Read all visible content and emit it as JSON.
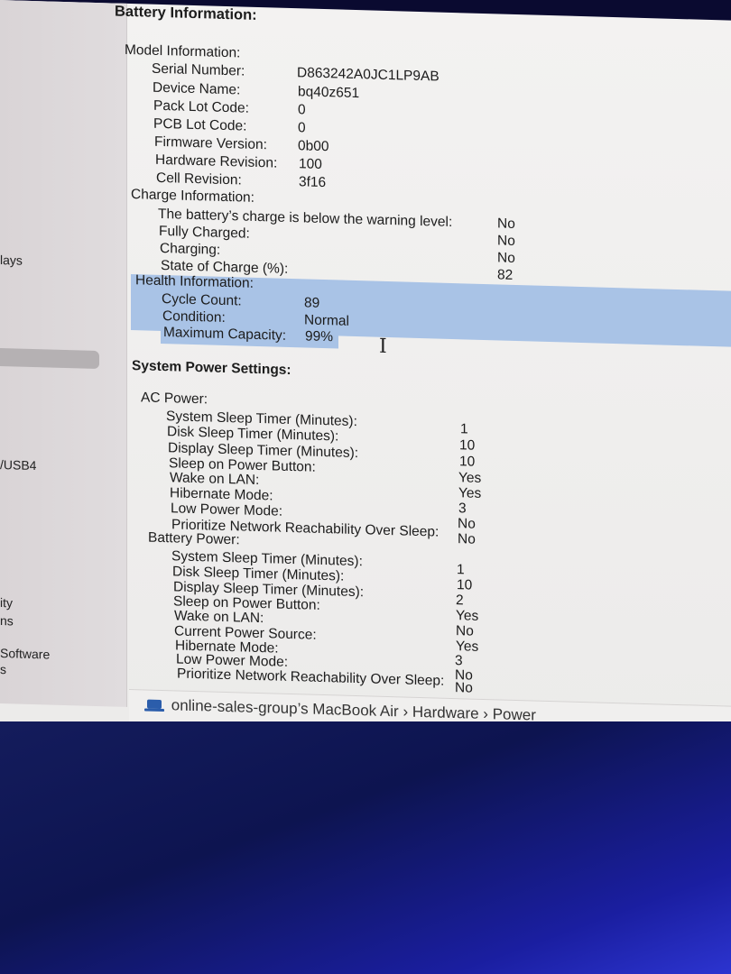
{
  "title": "Battery Information:",
  "sidebar": {
    "items": [
      "lays",
      "/USB4",
      "ity",
      "ns",
      "Software",
      "s"
    ]
  },
  "model": {
    "header": "Model Information:",
    "rows": [
      {
        "label": "Serial Number:",
        "value": "D863242A0JC1LP9AB"
      },
      {
        "label": "Device Name:",
        "value": "bq40z651"
      },
      {
        "label": "Pack Lot Code:",
        "value": "0"
      },
      {
        "label": "PCB Lot Code:",
        "value": "0"
      },
      {
        "label": "Firmware Version:",
        "value": "0b00"
      },
      {
        "label": "Hardware Revision:",
        "value": "100"
      },
      {
        "label": "Cell Revision:",
        "value": "3f16"
      }
    ]
  },
  "charge": {
    "header": "Charge Information:",
    "rows": [
      {
        "label": "The battery’s charge is below the warning level:",
        "value": "No"
      },
      {
        "label": "Fully Charged:",
        "value": "No"
      },
      {
        "label": "Charging:",
        "value": "No"
      },
      {
        "label": "State of Charge (%):",
        "value": "82"
      }
    ]
  },
  "health": {
    "header": "Health Information:",
    "rows": [
      {
        "label": "Cycle Count:",
        "value": "89"
      },
      {
        "label": "Condition:",
        "value": "Normal"
      },
      {
        "label": "Maximum Capacity:",
        "value": "99%"
      }
    ]
  },
  "system_power_title": "System Power Settings:",
  "ac_power": {
    "header": "AC Power:",
    "rows": [
      {
        "label": "System Sleep Timer (Minutes):",
        "value": "1"
      },
      {
        "label": "Disk Sleep Timer (Minutes):",
        "value": "10"
      },
      {
        "label": "Display Sleep Timer (Minutes):",
        "value": "10"
      },
      {
        "label": "Sleep on Power Button:",
        "value": "Yes"
      },
      {
        "label": "Wake on LAN:",
        "value": "Yes"
      },
      {
        "label": "Hibernate Mode:",
        "value": "3"
      },
      {
        "label": "Low Power Mode:",
        "value": "No"
      },
      {
        "label": "Prioritize Network Reachability Over Sleep:",
        "value": "No"
      }
    ]
  },
  "battery_power": {
    "header": "Battery Power:",
    "rows": [
      {
        "label": "System Sleep Timer (Minutes):",
        "value": "1"
      },
      {
        "label": "Disk Sleep Timer (Minutes):",
        "value": "10"
      },
      {
        "label": "Display Sleep Timer (Minutes):",
        "value": "2"
      },
      {
        "label": "Sleep on Power Button:",
        "value": "Yes"
      },
      {
        "label": "Wake on LAN:",
        "value": "No"
      },
      {
        "label": "Current Power Source:",
        "value": "Yes"
      },
      {
        "label": "Hibernate Mode:",
        "value": "3"
      },
      {
        "label": "Low Power Mode:",
        "value": "No"
      },
      {
        "label": "Prioritize Network Reachability Over Sleep:",
        "value": "No"
      }
    ]
  },
  "breadcrumb": {
    "icon": "laptop-icon",
    "parts": [
      "online-sales-group’s MacBook Air",
      "›",
      "Hardware",
      "›",
      "Power"
    ]
  }
}
